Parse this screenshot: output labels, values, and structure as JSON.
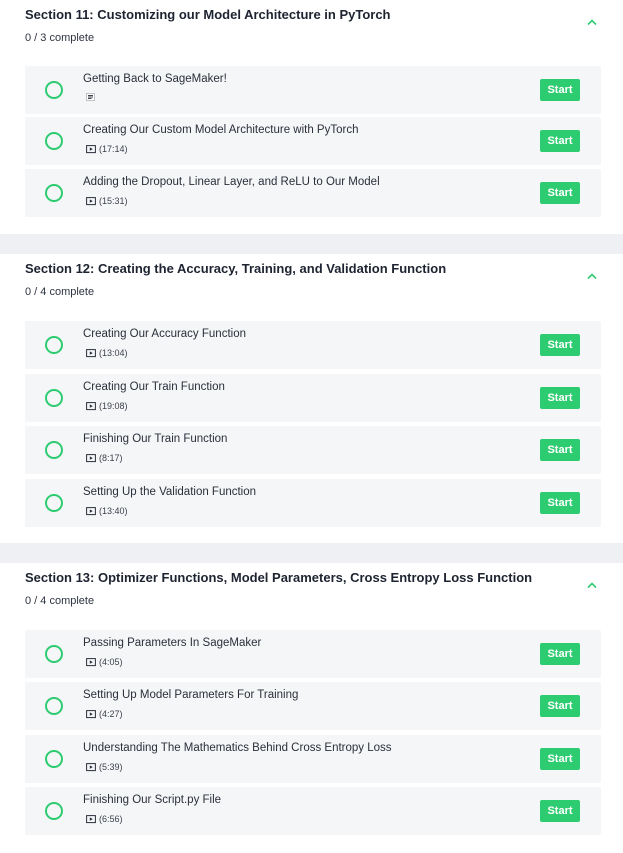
{
  "sections": [
    {
      "title": "Section 11: Customizing our Model Architecture in PyTorch",
      "progress": "0 / 3 complete",
      "lessons": [
        {
          "title": "Getting Back to SageMaker!",
          "kind": "text",
          "icon": "text-lines-icon",
          "duration": "",
          "action": "Start"
        },
        {
          "title": "Creating Our Custom Model Architecture with PyTorch",
          "kind": "video",
          "icon": "video-icon",
          "duration": "(17:14)",
          "action": "Start"
        },
        {
          "title": "Adding the Dropout, Linear Layer, and ReLU to Our Model",
          "kind": "video",
          "icon": "video-icon",
          "duration": "(15:31)",
          "action": "Start"
        }
      ]
    },
    {
      "title": "Section 12: Creating the Accuracy, Training, and Validation Function",
      "progress": "0 / 4 complete",
      "lessons": [
        {
          "title": "Creating Our Accuracy Function",
          "kind": "video",
          "icon": "video-icon",
          "duration": "(13:04)",
          "action": "Start"
        },
        {
          "title": "Creating Our Train Function",
          "kind": "video",
          "icon": "video-icon",
          "duration": "(19:08)",
          "action": "Start"
        },
        {
          "title": "Finishing Our Train Function",
          "kind": "video",
          "icon": "video-icon",
          "duration": "(8:17)",
          "action": "Start"
        },
        {
          "title": "Setting Up the Validation Function",
          "kind": "video",
          "icon": "video-icon",
          "duration": "(13:40)",
          "action": "Start"
        }
      ]
    },
    {
      "title": "Section 13: Optimizer Functions, Model Parameters, Cross Entropy Loss Function",
      "progress": "0 / 4 complete",
      "lessons": [
        {
          "title": "Passing Parameters In SageMaker",
          "kind": "video",
          "icon": "video-icon",
          "duration": "(4:05)",
          "action": "Start"
        },
        {
          "title": "Setting Up Model Parameters For Training",
          "kind": "video",
          "icon": "video-icon",
          "duration": "(4:27)",
          "action": "Start"
        },
        {
          "title": "Understanding The Mathematics Behind Cross Entropy Loss",
          "kind": "video",
          "icon": "video-icon",
          "duration": "(5:39)",
          "action": "Start"
        },
        {
          "title": "Finishing Our Script.py File",
          "kind": "video",
          "icon": "video-icon",
          "duration": "(6:56)",
          "action": "Start"
        }
      ]
    }
  ],
  "colors": {
    "accent": "#2ecc71",
    "page_background": "#eef0f3",
    "card_background": "#ffffff",
    "lesson_background": "#f5f6f8"
  },
  "icons": {
    "collapse": "chevron-up-icon",
    "status": "incomplete-circle-icon"
  }
}
